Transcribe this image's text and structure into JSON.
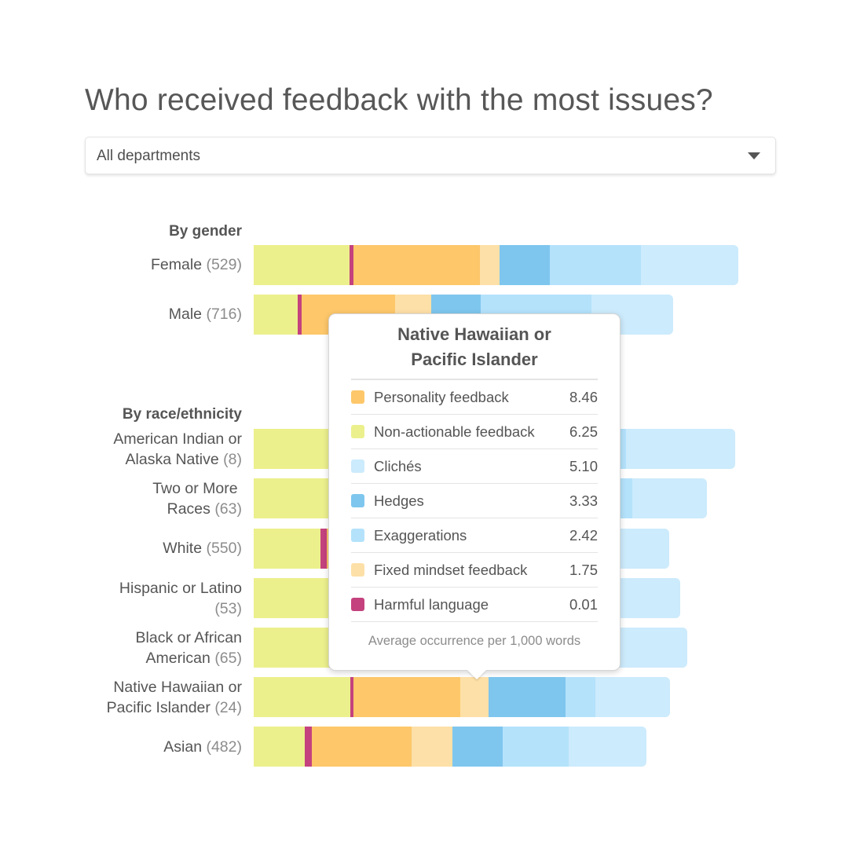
{
  "title": "Who received feedback with the most issues?",
  "filter": {
    "selected": "All departments",
    "icon": "caret-down-icon"
  },
  "categories": [
    {
      "key": "nonactionable",
      "label": "Non-actionable feedback",
      "color": "#ecf08c"
    },
    {
      "key": "harmful",
      "label": "Harmful language",
      "color": "#c4427e"
    },
    {
      "key": "personality",
      "label": "Personality feedback",
      "color": "#fdc76a"
    },
    {
      "key": "fixed",
      "label": "Fixed mindset feedback",
      "color": "#fde0a7"
    },
    {
      "key": "hedges",
      "label": "Hedges",
      "color": "#7ec6ee"
    },
    {
      "key": "exaggerations",
      "label": "Exaggerations",
      "color": "#b4e2fb"
    },
    {
      "key": "cliches",
      "label": "Clichés",
      "color": "#ccebfc"
    }
  ],
  "chart_data": {
    "type": "bar",
    "orientation": "horizontal-stacked",
    "title": "Who received feedback with the most issues?",
    "note": "Segment values are relative widths estimated from the bars (arbitrary common units); exact values only visible in tooltip",
    "series_order": [
      "nonactionable",
      "harmful",
      "personality",
      "fixed",
      "hedges",
      "exaggerations",
      "cliches"
    ],
    "groups": [
      {
        "label": "By gender",
        "rows": [
          {
            "name": "Female",
            "count": "(529)",
            "values": [
              6.1,
              0.25,
              8.05,
              1.25,
              3.2,
              5.8,
              6.2
            ]
          },
          {
            "name": "Male",
            "count": "(716)",
            "values": [
              2.8,
              0.25,
              5.95,
              2.3,
              3.15,
              7.05,
              5.2
            ]
          }
        ]
      },
      {
        "label": "By race/ethnicity",
        "rows": [
          {
            "name": "American Indian or Alaska Native",
            "count": "(8)",
            "values": [
              6.0,
              0.0,
              7.0,
              2.0,
              3.5,
              5.2,
              6.95
            ]
          },
          {
            "name": "Two or More Races",
            "count": "(63)",
            "values": [
              5.5,
              0.0,
              7.0,
              2.0,
              3.5,
              6.1,
              4.75
            ]
          },
          {
            "name": "White",
            "count": "(550)",
            "values": [
              4.25,
              0.4,
              6.5,
              2.2,
              3.5,
              3.5,
              6.1
            ]
          },
          {
            "name": "Hispanic or Latino",
            "count": "(53)",
            "values": [
              5.0,
              0.0,
              7.0,
              2.0,
              3.4,
              5.25,
              4.5
            ]
          },
          {
            "name": "Black or African American",
            "count": "(65)",
            "values": [
              4.8,
              0.1,
              6.5,
              2.0,
              3.5,
              4.0,
              6.7
            ]
          },
          {
            "name": "Native Hawaiian or Pacific Islander",
            "count": "(24)",
            "values": [
              6.15,
              0.2,
              6.8,
              1.8,
              4.9,
              1.9,
              4.75
            ]
          },
          {
            "name": "Asian",
            "count": "(482)",
            "values": [
              3.25,
              0.45,
              6.35,
              2.6,
              3.2,
              4.2,
              4.95
            ]
          }
        ]
      }
    ]
  },
  "labels": {
    "gender_header": "By gender",
    "race_header": "By race/ethnicity",
    "female": "Female",
    "female_count": "(529)",
    "male": "Male",
    "male_count": "(716)",
    "aian_1": "American Indian or",
    "aian_2": "Alaska Native",
    "aian_count": "(8)",
    "two_1": "Two or More",
    "two_2": "Races",
    "two_count": "(63)",
    "white": "White",
    "white_count": "(550)",
    "hisp_1": "Hispanic or Latino",
    "hisp_count": "(53)",
    "black_1": "Black or African",
    "black_2": "American",
    "black_count": "(65)",
    "nh_1": "Native Hawaiian or",
    "nh_2": "Pacific Islander",
    "nh_count": "(24)",
    "asian": "Asian",
    "asian_count": "(482)"
  },
  "tooltip": {
    "title_line1": "Native Hawaiian or",
    "title_line2": "Pacific Islander",
    "rows": [
      {
        "label": "Personality feedback",
        "value": "8.46",
        "color": "#fdc76a"
      },
      {
        "label": "Non-actionable feedback",
        "value": "6.25",
        "color": "#ecf08c"
      },
      {
        "label": "Clichés",
        "value": "5.10",
        "color": "#ccebfc"
      },
      {
        "label": "Hedges",
        "value": "3.33",
        "color": "#7ec6ee"
      },
      {
        "label": "Exaggerations",
        "value": "2.42",
        "color": "#b4e2fb"
      },
      {
        "label": "Fixed mindset feedback",
        "value": "1.75",
        "color": "#fde0a7"
      },
      {
        "label": "Harmful language",
        "value": "0.01",
        "color": "#c4427e"
      }
    ],
    "note": "Average occurrence per 1,000 words"
  }
}
